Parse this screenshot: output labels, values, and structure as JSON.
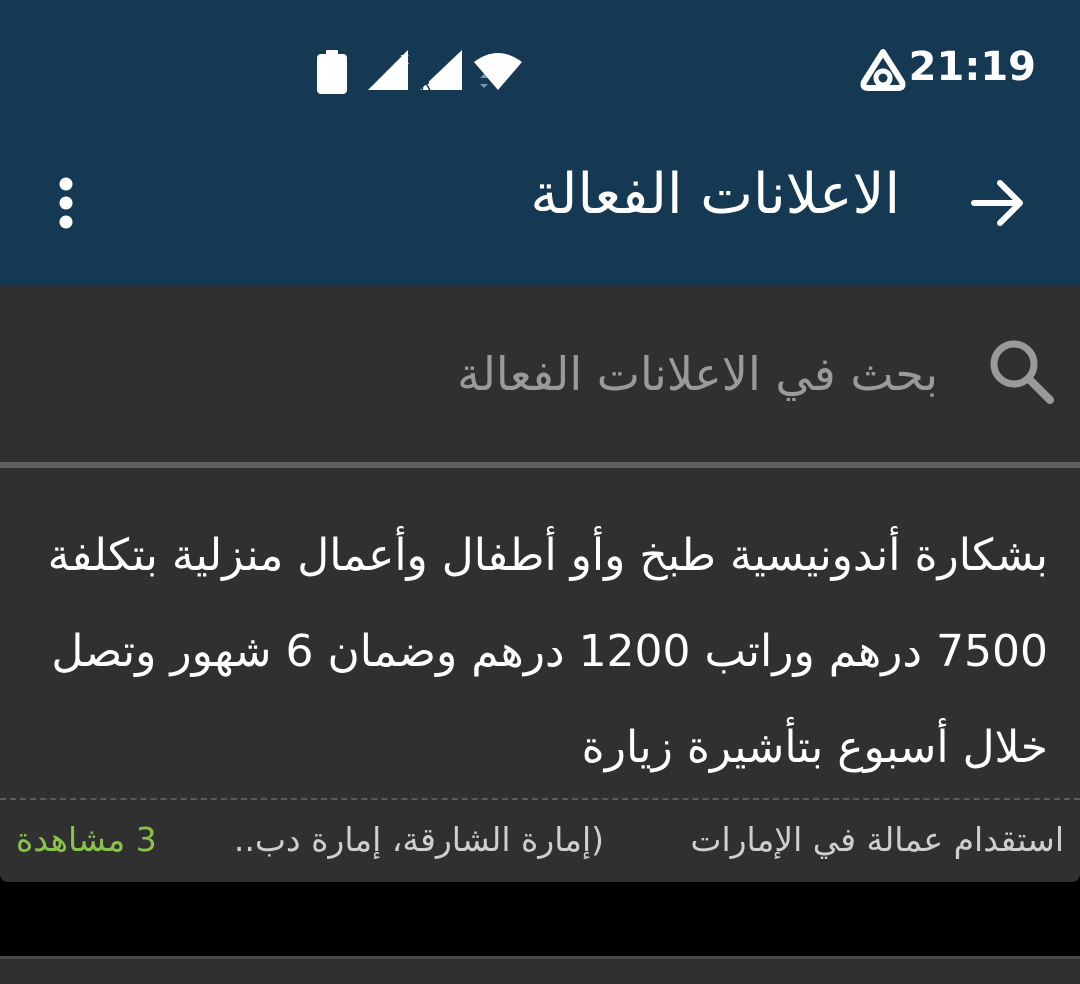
{
  "status_bar": {
    "time": "21:19",
    "icons": [
      "battery-icon",
      "no-signal-sim-icon",
      "roaming-signal-icon",
      "wifi-icon",
      "sync-app-icon"
    ]
  },
  "app_bar": {
    "title": "الاعلانات الفعالة",
    "back_icon": "arrow-right-icon",
    "menu_icon": "more-vertical-icon"
  },
  "search": {
    "placeholder": "بحث في الاعلانات الفعالة",
    "icon": "search-icon"
  },
  "ads": [
    {
      "text": "بشكارة أندونيسية طبخ وأو أطفال وأعمال منزلية بتكلفة 7500 درهم وراتب 1200 درهم وضمان 6 شهور وتصل خلال أسبوع بتأشيرة زيارة",
      "category": "استقدام عمالة في الإمارات",
      "location": "(إمارة الشارقة، إمارة دب..",
      "views": "3 مشاهدة"
    }
  ],
  "colors": {
    "app_bar": "#153952",
    "card": "#303030",
    "views": "#8bc34a",
    "background": "#000000"
  }
}
